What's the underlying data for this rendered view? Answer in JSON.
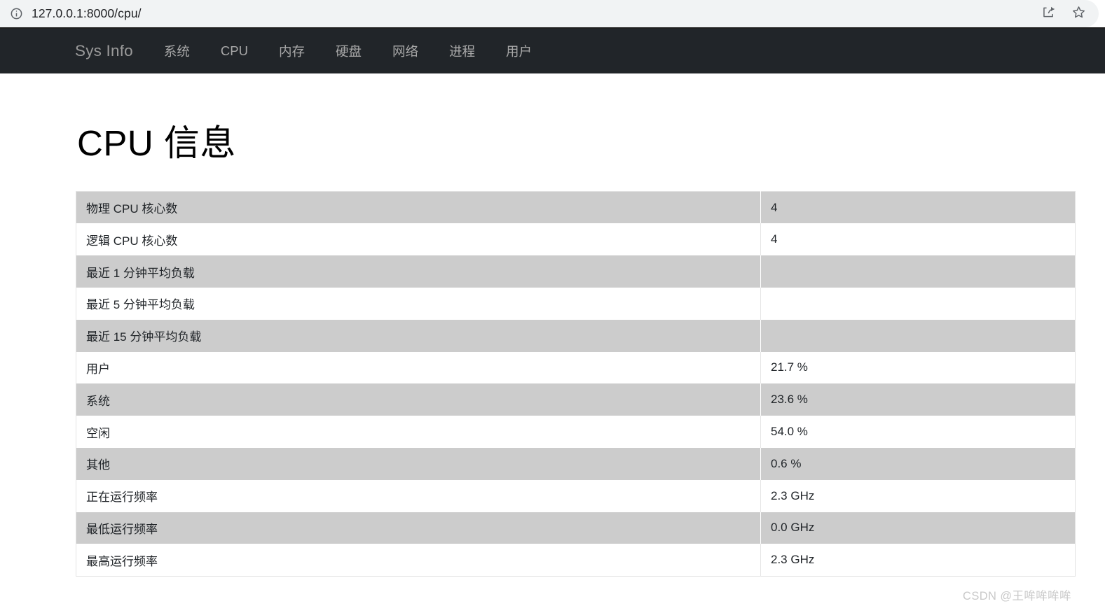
{
  "browser": {
    "url": "127.0.0.1:8000/cpu/",
    "site_info_icon": "info-circle-icon",
    "share_icon": "share-icon",
    "bookmark_icon": "star-outline-icon"
  },
  "navbar": {
    "brand": "Sys Info",
    "items": [
      {
        "label": "系统"
      },
      {
        "label": "CPU"
      },
      {
        "label": "内存"
      },
      {
        "label": "硬盘"
      },
      {
        "label": "网络"
      },
      {
        "label": "进程"
      },
      {
        "label": "用户"
      }
    ]
  },
  "main": {
    "title": "CPU 信息",
    "table": {
      "rows": [
        {
          "label": "物理 CPU 核心数",
          "value": "4"
        },
        {
          "label": "逻辑 CPU 核心数",
          "value": "4"
        },
        {
          "label": "最近 1 分钟平均负载",
          "value": ""
        },
        {
          "label": "最近 5 分钟平均负载",
          "value": ""
        },
        {
          "label": "最近 15 分钟平均负载",
          "value": ""
        },
        {
          "label": "用户",
          "value": "21.7 %"
        },
        {
          "label": "系统",
          "value": "23.6 %"
        },
        {
          "label": "空闲",
          "value": "54.0 %"
        },
        {
          "label": "其他",
          "value": "0.6 %"
        },
        {
          "label": "正在运行频率",
          "value": "2.3 GHz"
        },
        {
          "label": "最低运行频率",
          "value": "0.0 GHz"
        },
        {
          "label": "最高运行频率",
          "value": "2.3 GHz"
        }
      ]
    }
  },
  "watermark": {
    "text": "CSDN @王哞哞哞哞"
  },
  "colors": {
    "navbar_bg": "#212529",
    "row_stripe": "#cccccc",
    "omnibox_bg": "#f1f3f4"
  }
}
